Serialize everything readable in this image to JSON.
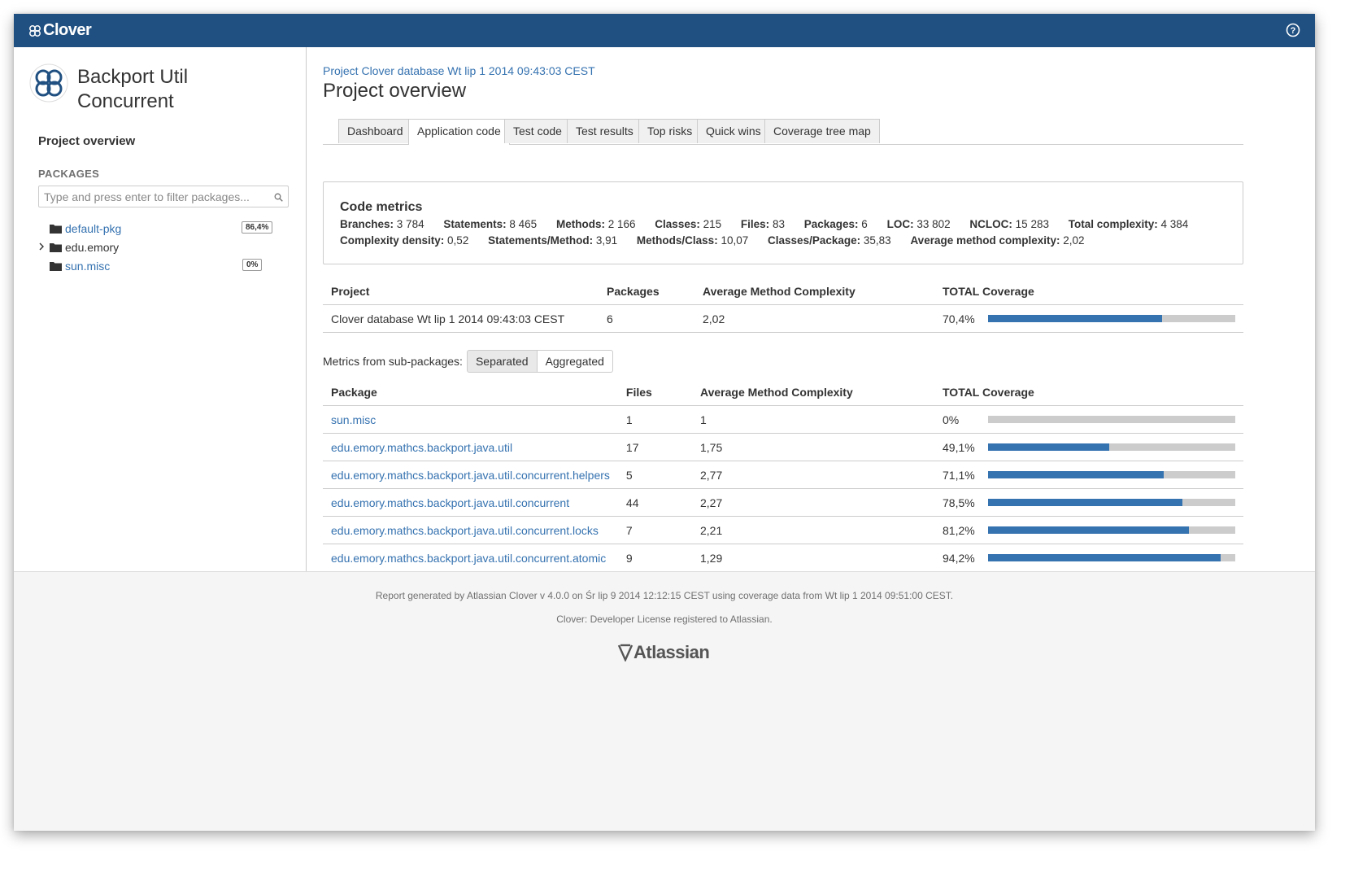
{
  "app": {
    "name": "Clover",
    "brand_color": "#205081",
    "accent_color": "#3572b0"
  },
  "sidebar": {
    "project_name": "Backport Util Concurrent",
    "project_overview_label": "Project overview",
    "packages_heading": "PACKAGES",
    "filter_placeholder": "Type and press enter to filter packages...",
    "packages": [
      {
        "label": "default-pkg",
        "badge": "86,4%",
        "expandable": false,
        "link": true
      },
      {
        "label": "edu.emory",
        "badge": "",
        "expandable": true,
        "link": false
      },
      {
        "label": "sun.misc",
        "badge": "0%",
        "expandable": false,
        "link": true
      }
    ]
  },
  "main": {
    "breadcrumb": "Project Clover database Wt lip 1 2014 09:43:03 CEST",
    "title": "Project overview",
    "tabs": [
      {
        "label": "Dashboard"
      },
      {
        "label": "Application code",
        "active": true
      },
      {
        "label": "Test code"
      },
      {
        "label": "Test results"
      },
      {
        "label": "Top risks"
      },
      {
        "label": "Quick wins"
      },
      {
        "label": "Coverage tree map"
      }
    ],
    "code_metrics": {
      "title": "Code metrics",
      "row1": [
        {
          "k": "Branches:",
          "v": "3 784"
        },
        {
          "k": "Statements:",
          "v": "8 465"
        },
        {
          "k": "Methods:",
          "v": "2 166"
        },
        {
          "k": "Classes:",
          "v": "215"
        },
        {
          "k": "Files:",
          "v": "83"
        },
        {
          "k": "Packages:",
          "v": "6"
        },
        {
          "k": "LOC:",
          "v": "33 802"
        },
        {
          "k": "NCLOC:",
          "v": "15 283"
        },
        {
          "k": "Total complexity:",
          "v": "4 384"
        }
      ],
      "row2": [
        {
          "k": "Complexity density:",
          "v": "0,52"
        },
        {
          "k": "Statements/Method:",
          "v": "3,91"
        },
        {
          "k": "Methods/Class:",
          "v": "10,07"
        },
        {
          "k": "Classes/Package:",
          "v": "35,83"
        },
        {
          "k": "Average method complexity:",
          "v": "2,02"
        }
      ]
    },
    "project_table": {
      "headers": [
        "Project",
        "Packages",
        "Average Method Complexity",
        "TOTAL Coverage"
      ],
      "rows": [
        {
          "name": "Clover database Wt lip 1 2014 09:43:03 CEST",
          "packages": "6",
          "amc": "2,02",
          "coverage": "70,4%",
          "coverage_value": 70.4
        }
      ]
    },
    "subpackages": {
      "label": "Metrics from sub-packages:",
      "options": [
        "Separated",
        "Aggregated"
      ],
      "selected": "Separated"
    },
    "package_table": {
      "headers": [
        "Package",
        "Files",
        "Average Method Complexity",
        "TOTAL Coverage"
      ],
      "rows": [
        {
          "name": "sun.misc",
          "files": "1",
          "amc": "1",
          "coverage": "0%",
          "coverage_value": 0
        },
        {
          "name": "edu.emory.mathcs.backport.java.util",
          "files": "17",
          "amc": "1,75",
          "coverage": "49,1%",
          "coverage_value": 49.1
        },
        {
          "name": "edu.emory.mathcs.backport.java.util.concurrent.helpers",
          "files": "5",
          "amc": "2,77",
          "coverage": "71,1%",
          "coverage_value": 71.1
        },
        {
          "name": "edu.emory.mathcs.backport.java.util.concurrent",
          "files": "44",
          "amc": "2,27",
          "coverage": "78,5%",
          "coverage_value": 78.5
        },
        {
          "name": "edu.emory.mathcs.backport.java.util.concurrent.locks",
          "files": "7",
          "amc": "2,21",
          "coverage": "81,2%",
          "coverage_value": 81.2
        },
        {
          "name": "edu.emory.mathcs.backport.java.util.concurrent.atomic",
          "files": "9",
          "amc": "1,29",
          "coverage": "94,2%",
          "coverage_value": 94.2
        }
      ]
    }
  },
  "footer": {
    "line1": "Report generated by Atlassian Clover v 4.0.0 on Śr lip 9 2014 12:12:15 CEST using coverage data from Wt lip 1 2014 09:51:00 CEST.",
    "line2": "Clover: Developer License registered to Atlassian.",
    "logo_text": "Atlassian"
  }
}
